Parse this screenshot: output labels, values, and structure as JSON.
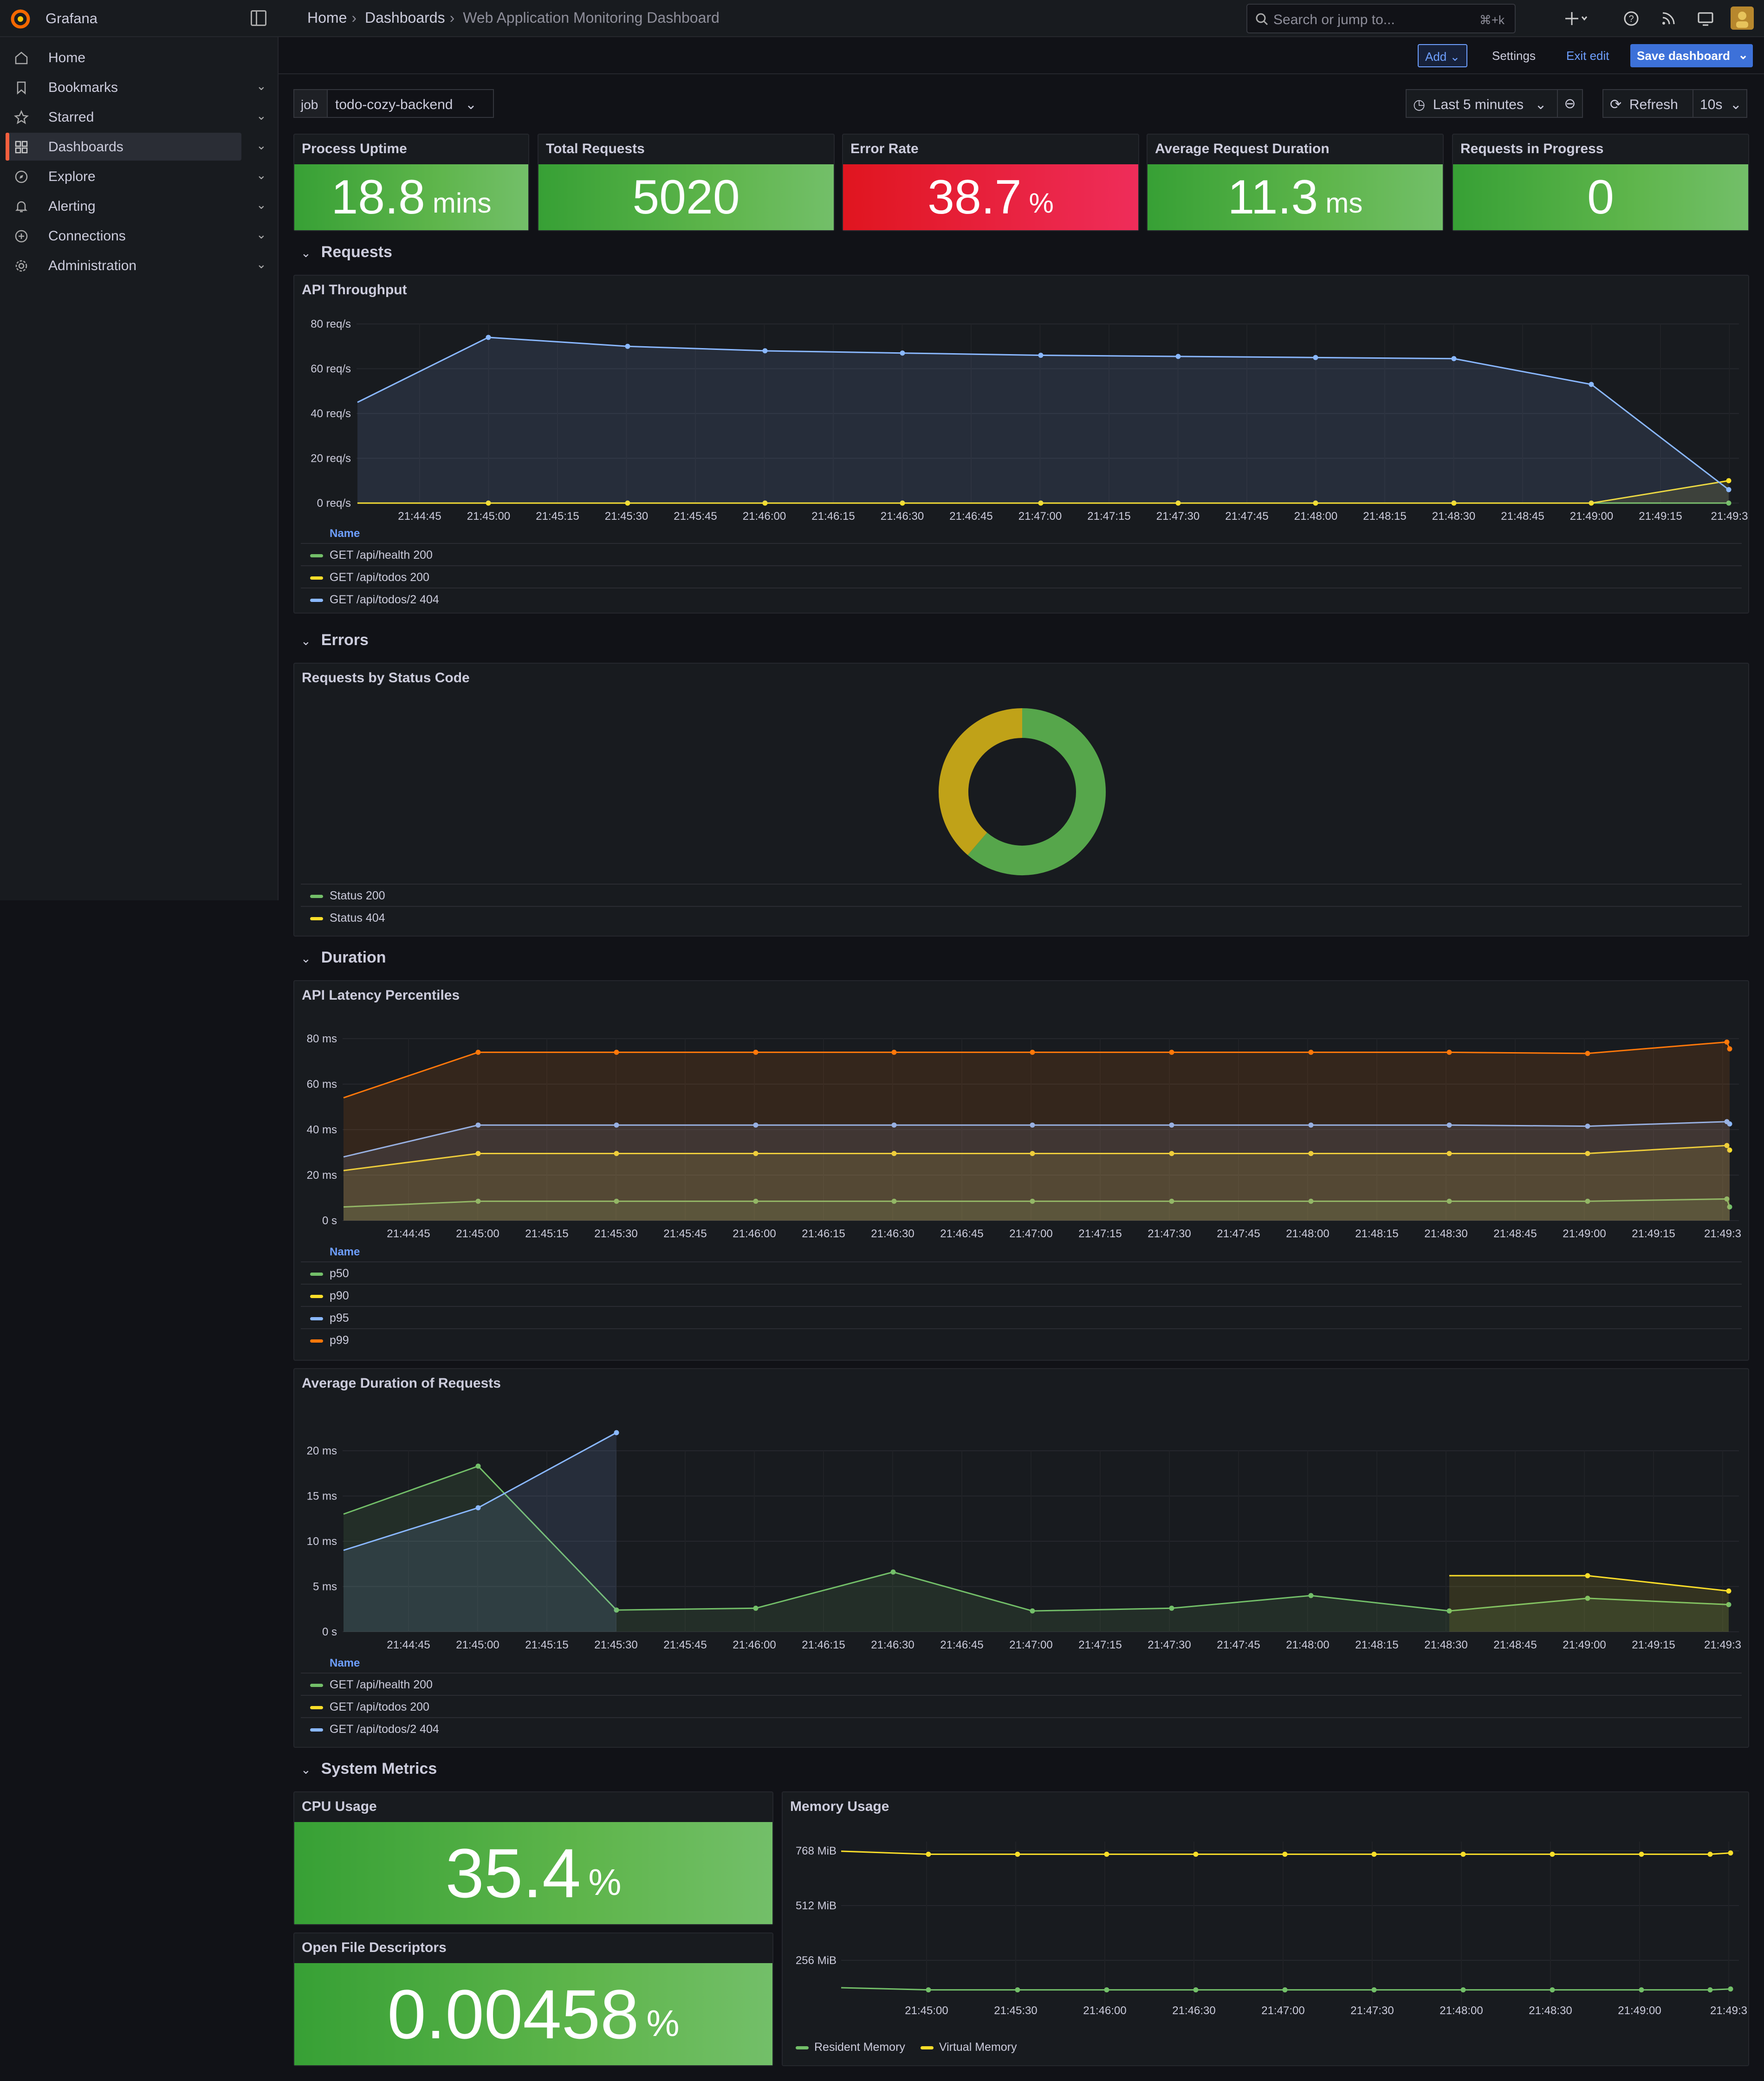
{
  "app": {
    "name": "Grafana"
  },
  "breadcrumb": [
    "Home",
    "Dashboards",
    "Web Application Monitoring Dashboard"
  ],
  "search": {
    "placeholder": "Search or jump to...",
    "shortcut": "⌘+k"
  },
  "nav": [
    {
      "label": "Home",
      "icon": "home-icon",
      "expandable": false
    },
    {
      "label": "Bookmarks",
      "icon": "bookmark-icon",
      "expandable": true
    },
    {
      "label": "Starred",
      "icon": "star-icon",
      "expandable": true
    },
    {
      "label": "Dashboards",
      "icon": "dashboards-icon",
      "expandable": true,
      "active": true
    },
    {
      "label": "Explore",
      "icon": "compass-icon",
      "expandable": true
    },
    {
      "label": "Alerting",
      "icon": "bell-icon",
      "expandable": true
    },
    {
      "label": "Connections",
      "icon": "connections-icon",
      "expandable": true
    },
    {
      "label": "Administration",
      "icon": "gear-icon",
      "expandable": true
    }
  ],
  "toolbar": {
    "add": "Add",
    "settings": "Settings",
    "exit_edit": "Exit edit",
    "save": "Save dashboard"
  },
  "variables": {
    "job_label": "job",
    "job_value": "todo-cozy-backend"
  },
  "time": {
    "range": "Last 5 minutes",
    "refresh": "Refresh",
    "interval": "10s"
  },
  "stats": [
    {
      "title": "Process Uptime",
      "value": "18.8",
      "unit": "mins",
      "status": "green"
    },
    {
      "title": "Total Requests",
      "value": "5020",
      "unit": "",
      "status": "green"
    },
    {
      "title": "Error Rate",
      "value": "38.7",
      "unit": "%",
      "status": "red"
    },
    {
      "title": "Average Request Duration",
      "value": "11.3",
      "unit": "ms",
      "status": "green"
    },
    {
      "title": "Requests in Progress",
      "value": "0",
      "unit": "",
      "status": "green"
    }
  ],
  "rows": {
    "requests": "Requests",
    "errors": "Errors",
    "duration": "Duration",
    "system": "System Metrics"
  },
  "panels": {
    "throughput": {
      "title": "API Throughput",
      "legend_header": "Name",
      "y_ticks": [
        "80 req/s",
        "60 req/s",
        "40 req/s",
        "20 req/s",
        "0 req/s"
      ],
      "x_ticks": [
        "21:44:45",
        "21:45:00",
        "21:45:15",
        "21:45:30",
        "21:45:45",
        "21:46:00",
        "21:46:15",
        "21:46:30",
        "21:46:45",
        "21:47:00",
        "21:47:15",
        "21:47:30",
        "21:47:45",
        "21:48:00",
        "21:48:15",
        "21:48:30",
        "21:48:45",
        "21:49:00",
        "21:49:15",
        "21:49:3"
      ],
      "series": [
        {
          "name": "GET /api/health 200",
          "color": "#73bf69",
          "values": [
            0,
            0,
            0,
            0,
            0,
            0,
            0,
            0,
            0,
            0,
            0
          ]
        },
        {
          "name": "GET /api/todos 200",
          "color": "#fade2a",
          "values": [
            0,
            0,
            0,
            0,
            0,
            0,
            0,
            0,
            0,
            0,
            10
          ]
        },
        {
          "name": "GET /api/todos/2 404",
          "color": "#8ab8ff",
          "values": [
            45,
            74,
            70,
            68,
            67,
            66,
            65.5,
            65,
            64.5,
            53,
            6
          ]
        }
      ]
    },
    "status_codes": {
      "title": "Requests by Status Code",
      "slices": [
        {
          "name": "Status 200",
          "color": "#56a64b",
          "value": 61.3
        },
        {
          "name": "Status 404",
          "color": "#c0a218",
          "value": 38.7
        }
      ]
    },
    "latency": {
      "title": "API Latency Percentiles",
      "legend_header": "Name",
      "y_ticks": [
        "80 ms",
        "60 ms",
        "40 ms",
        "20 ms",
        "0 s"
      ],
      "x_ticks": [
        "21:44:45",
        "21:45:00",
        "21:45:15",
        "21:45:30",
        "21:45:45",
        "21:46:00",
        "21:46:15",
        "21:46:30",
        "21:46:45",
        "21:47:00",
        "21:47:15",
        "21:47:30",
        "21:47:45",
        "21:48:00",
        "21:48:15",
        "21:48:30",
        "21:48:45",
        "21:49:00",
        "21:49:15",
        "21:49:3"
      ],
      "series": [
        {
          "name": "p50",
          "color": "#73bf69",
          "values": [
            6,
            8.5,
            8.5,
            8.5,
            8.5,
            8.5,
            8.5,
            8.5,
            8.5,
            8.5,
            9.5,
            6
          ]
        },
        {
          "name": "p90",
          "color": "#fade2a",
          "values": [
            22,
            29.5,
            29.5,
            29.5,
            29.5,
            29.5,
            29.5,
            29.5,
            29.5,
            29.5,
            33,
            31
          ]
        },
        {
          "name": "p95",
          "color": "#8ab8ff",
          "values": [
            28,
            42,
            42,
            42,
            42,
            42,
            42,
            42,
            42,
            41.5,
            43.5,
            42.5
          ]
        },
        {
          "name": "p99",
          "color": "#ff780a",
          "values": [
            54,
            74,
            74,
            74,
            74,
            74,
            74,
            74,
            74,
            73.5,
            78.5,
            75.5
          ]
        }
      ]
    },
    "avg_duration": {
      "title": "Average Duration of Requests",
      "legend_header": "Name",
      "y_ticks": [
        "20 ms",
        "15 ms",
        "10 ms",
        "5 ms",
        "0 s"
      ],
      "x_ticks": [
        "21:44:45",
        "21:45:00",
        "21:45:15",
        "21:45:30",
        "21:45:45",
        "21:46:00",
        "21:46:15",
        "21:46:30",
        "21:46:45",
        "21:47:00",
        "21:47:15",
        "21:47:30",
        "21:47:45",
        "21:48:00",
        "21:48:15",
        "21:48:30",
        "21:48:45",
        "21:49:00",
        "21:49:15",
        "21:49:3"
      ],
      "series": [
        {
          "name": "GET /api/health 200",
          "color": "#73bf69",
          "values": [
            13,
            18.3,
            2.4,
            2.6,
            6.6,
            2.3,
            2.6,
            4,
            2.3,
            3.7,
            3
          ]
        },
        {
          "name": "GET /api/todos 200",
          "color": "#fade2a",
          "values": [
            null,
            null,
            null,
            null,
            null,
            null,
            null,
            null,
            6.2,
            6.2,
            4.5
          ]
        },
        {
          "name": "GET /api/todos/2 404",
          "color": "#8ab8ff",
          "values": [
            9,
            13.7,
            22,
            null,
            null,
            null,
            null,
            null,
            null,
            null,
            null
          ]
        }
      ]
    },
    "cpu": {
      "title": "CPU Usage",
      "value": "35.4",
      "unit": "%"
    },
    "fds": {
      "title": "Open File Descriptors",
      "value": "0.00458",
      "unit": "%"
    },
    "memory": {
      "title": "Memory Usage",
      "y_ticks": [
        "768 MiB",
        "512 MiB",
        "256 MiB"
      ],
      "x_ticks": [
        "21:45:00",
        "21:45:30",
        "21:46:00",
        "21:46:30",
        "21:47:00",
        "21:47:30",
        "21:48:00",
        "21:48:30",
        "21:49:00",
        "21:49:3"
      ],
      "series": [
        {
          "name": "Resident Memory",
          "color": "#73bf69",
          "values": [
            128,
            118,
            118,
            118,
            118,
            118,
            118,
            118,
            118,
            118,
            118,
            122
          ]
        },
        {
          "name": "Virtual Memory",
          "color": "#fade2a",
          "values": [
            766,
            752,
            752,
            752,
            752,
            752,
            752,
            752,
            752,
            752,
            752,
            758
          ]
        }
      ]
    }
  }
}
